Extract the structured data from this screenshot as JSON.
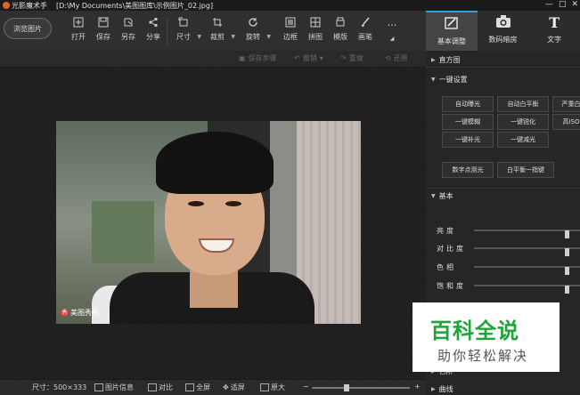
{
  "title": {
    "app_name": "光影魔术手",
    "file_path": "[D:\\My Documents\\美图图库\\示例图片_02.jpg]",
    "win_controls": [
      "—",
      "□",
      "✕"
    ]
  },
  "toolbar": {
    "browse_label": "浏览图片",
    "tools": [
      {
        "label": "打开",
        "icon": "open-icon"
      },
      {
        "label": "保存",
        "icon": "save-icon"
      },
      {
        "label": "另存",
        "icon": "save-as-icon"
      },
      {
        "label": "分享",
        "icon": "share-icon"
      },
      {
        "label": "尺寸",
        "icon": "resize-icon"
      },
      {
        "label": "裁剪",
        "icon": "crop-icon"
      },
      {
        "label": "旋转",
        "icon": "rotate-icon"
      },
      {
        "label": "边框",
        "icon": "border-icon"
      },
      {
        "label": "拼图",
        "icon": "collage-icon"
      },
      {
        "label": "模版",
        "icon": "template-icon"
      },
      {
        "label": "画笔",
        "icon": "brush-icon"
      },
      {
        "label": "…",
        "icon": "more-icon"
      }
    ]
  },
  "right_tabs": [
    {
      "label": "基本调整",
      "icon": "adjust-icon",
      "active": true
    },
    {
      "label": "数码暗房",
      "icon": "camera-icon",
      "active": false
    },
    {
      "label": "文字",
      "icon": "text-icon",
      "active": false
    }
  ],
  "subbar": {
    "save_step": "保存步骤",
    "undo": "撤销",
    "redo": "重做",
    "restore": "还原"
  },
  "photo": {
    "watermark": "美图秀秀"
  },
  "statusbar": {
    "size_label": "尺寸：500×333",
    "info": "图片信息",
    "compare": "对比",
    "fullscreen": "全屏",
    "fit": "适屏",
    "original": "原大",
    "zoom_out": "−",
    "zoom_in": "+",
    "zoom_level": 0.35
  },
  "right_panel": {
    "histogram": "直方图",
    "one_click": "一键设置",
    "quick_buttons": [
      "自动曝光",
      "自动白平衡",
      "严重白",
      "一键模糊",
      "一键锐化",
      "高ISO",
      "一键补光",
      "一键减光"
    ],
    "quick_buttons_2": [
      "数字点测光",
      "白平衡一指键"
    ],
    "basic": "基本",
    "sliders": [
      {
        "label": "亮度",
        "value": 0.5
      },
      {
        "label": "对比度",
        "value": 0.5
      },
      {
        "label": "色相",
        "value": 0.5
      },
      {
        "label": "饱和度",
        "value": 0.5
      }
    ],
    "color": "色阶",
    "curve": "曲线"
  },
  "badge": {
    "line1": "百科全说",
    "line2": "助你轻松解决"
  }
}
